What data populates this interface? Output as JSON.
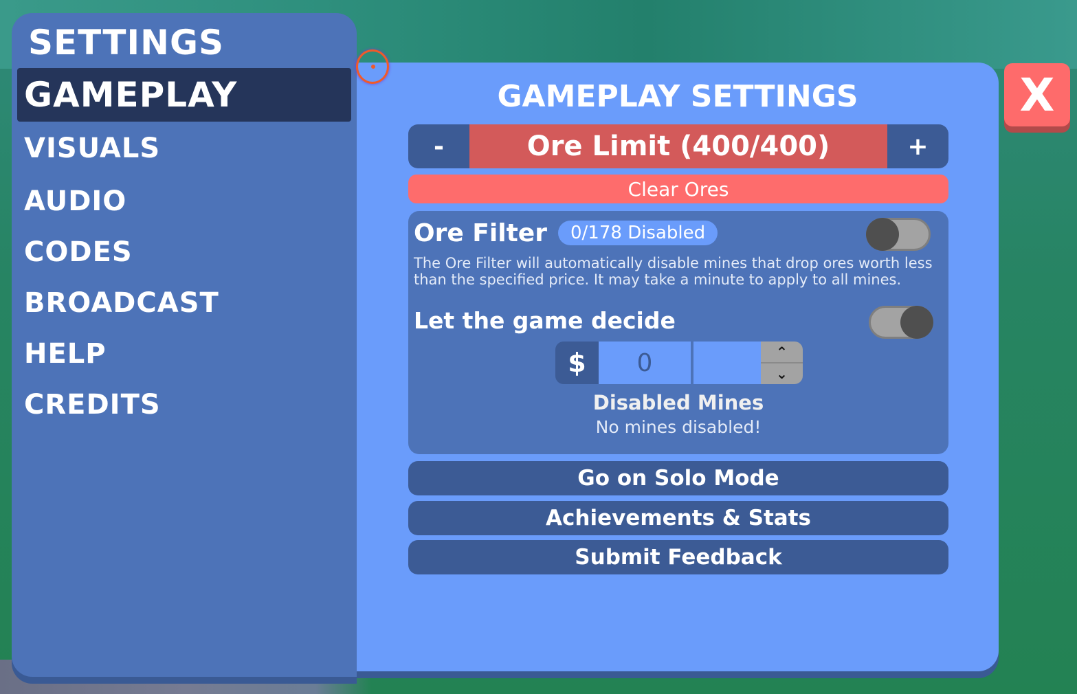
{
  "sidebar": {
    "title": "SETTINGS",
    "items": [
      {
        "label": "GAMEPLAY",
        "active": true
      },
      {
        "label": "VISUALS",
        "active": false
      },
      {
        "label": "AUDIO",
        "active": false
      },
      {
        "label": "CODES",
        "active": false
      },
      {
        "label": "BROADCAST",
        "active": false
      },
      {
        "label": "HELP",
        "active": false
      },
      {
        "label": "CREDITS",
        "active": false
      }
    ]
  },
  "main": {
    "title": "GAMEPLAY SETTINGS",
    "ore_limit": {
      "decrement_label": "-",
      "label": "Ore Limit (400/400)",
      "increment_label": "+"
    },
    "clear_ores_label": "Clear Ores",
    "ore_filter": {
      "title": "Ore Filter",
      "badge": "0/178 Disabled",
      "enabled": false,
      "description": "The Ore Filter will automatically disable mines that drop ores worth less than the specified price. It may take a minute to apply to all mines.",
      "let_game_decide_label": "Let the game decide",
      "let_game_decide_enabled": true,
      "currency_symbol": "$",
      "price_value": "0",
      "step_up_icon": "chevron-up-icon",
      "step_down_icon": "chevron-down-icon",
      "step_up_glyph": "⌃",
      "step_down_glyph": "⌄",
      "disabled_mines_title": "Disabled Mines",
      "disabled_mines_text": "No mines disabled!"
    },
    "buttons": {
      "solo_mode": "Go on Solo Mode",
      "achievements": "Achievements & Stats",
      "feedback": "Submit Feedback"
    }
  },
  "close_button": {
    "label": "X",
    "icon": "close-icon"
  },
  "colors": {
    "sidebar_bg": "#4d73b8",
    "active_nav_bg": "#25355a",
    "main_bg": "#6a9cfb",
    "button_dark": "#3c5b95",
    "ore_limit_red": "#d35a5a",
    "clear_red": "#fe6c6c",
    "close_red": "#fe6b6b"
  }
}
